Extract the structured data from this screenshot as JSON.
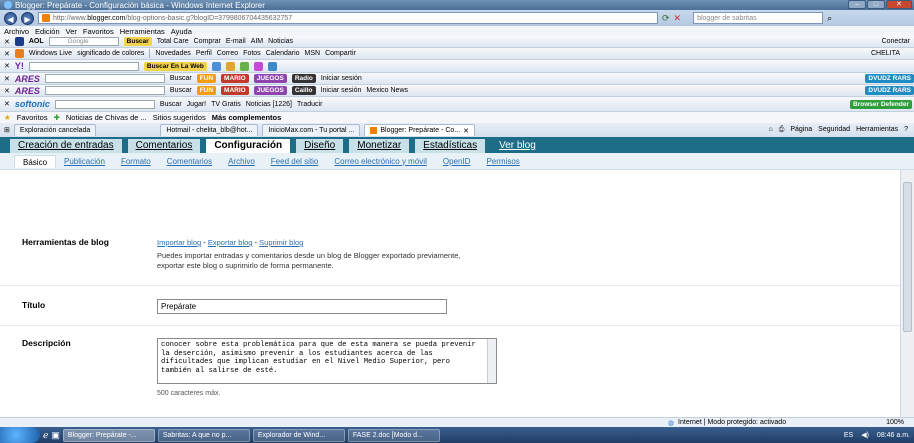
{
  "window": {
    "title": "Blogger: Prepárate - Configuración básica - Windows Internet Explorer"
  },
  "address": {
    "url_prefix": "http://www.",
    "url_domain": "blogger.com",
    "url_rest": "/blog-options-basic.g?blogID=3799806704435632757",
    "search_placeholder": "blogger de sabritas"
  },
  "menu": [
    "Archivo",
    "Edición",
    "Ver",
    "Favoritos",
    "Herramientas",
    "Ayuda"
  ],
  "toolbars": {
    "google": {
      "aol": "AOL",
      "google_label": "Google",
      "buscar": "Buscar",
      "total_care": "Total Care",
      "comprar": "Comprar",
      "email": "E-mail",
      "aim": "AIM",
      "noticias": "Noticias",
      "right": "Conectar"
    },
    "live": {
      "brand": "Windows Live",
      "query": "significado de colores",
      "items": [
        "Novedades",
        "Perfil",
        "Correo",
        "Fotos",
        "Calendario",
        "MSN",
        "Compartir"
      ],
      "user": "CHELITA"
    },
    "yahoo": {
      "buscar": "Buscar En La Web"
    },
    "ares1": {
      "brand": "ARES",
      "buscar": "Buscar",
      "fun": "FUN",
      "mario": "MARIO",
      "juegos": "JUEGOS",
      "radio": "Radio",
      "iniciar": "Iniciar sesión",
      "badge": "DVUDZ RARS"
    },
    "ares2": {
      "brand": "ARES",
      "buscar": "Buscar",
      "fun": "FUN",
      "mario": "MARIO",
      "juegos": "JUEGOS",
      "radio": "Caillo",
      "iniciar": "Iniciar sesión",
      "news": "Mexico News",
      "badge": "DVUDZ RARS"
    },
    "softonic": {
      "brand": "softonic",
      "buscar": "Buscar",
      "jugar": "Jugar!",
      "tv": "TV Gratis",
      "noticias": "Noticias [1226]",
      "traducir": "Traducir",
      "defender": "Browser Defender"
    }
  },
  "favorites": {
    "label": "Favoritos",
    "noticias": "Noticias de Chivas de ...",
    "sitios": "Sitios sugeridos",
    "mas": "Más complementos"
  },
  "tabs": [
    {
      "label": "Exploración cancelada"
    },
    {
      "label": "Hotmail - chelita_blb@hot..."
    },
    {
      "label": "InicioMax.com - Tu portal ..."
    },
    {
      "label": "Blogger: Prepárate - Co..."
    }
  ],
  "cmdbar": {
    "pagina": "Página",
    "seguridad": "Seguridad",
    "herramientas": "Herramientas"
  },
  "blogger_tabs": [
    {
      "label": "Creación de entradas"
    },
    {
      "label": "Comentarios"
    },
    {
      "label": "Configuración"
    },
    {
      "label": "Diseño"
    },
    {
      "label": "Monetizar"
    },
    {
      "label": "Estadísticas"
    },
    {
      "label": "Ver blog"
    }
  ],
  "blogger_subtabs": [
    {
      "label": "Básico"
    },
    {
      "label": "Publicación"
    },
    {
      "label": "Formato"
    },
    {
      "label": "Comentarios"
    },
    {
      "label": "Archivo"
    },
    {
      "label": "Feed del sitio"
    },
    {
      "label": "Correo electrónico y móvil"
    },
    {
      "label": "OpenID"
    },
    {
      "label": "Permisos"
    }
  ],
  "tools": {
    "label": "Herramientas de blog",
    "import": "Importar blog",
    "export": "Exportar blog",
    "delete": "Suprimir blog",
    "sep": " - ",
    "desc": "Puedes importar entradas y comentarios desde un blog de Blogger exportado previamente, exportar este blog o suprimirlo de forma permanente."
  },
  "title_section": {
    "label": "Título",
    "value": "Prepárate"
  },
  "description_section": {
    "label": "Descripción",
    "value": "conocer sobre esta problemática para  que de esta manera se  pueda prevenir la deserción, asimismo prevenir a los estudiantes acerca de las dificultades que implican estudiar en el Nivel Medio Superior,  pero también al salirse de esté.",
    "hint": "500 caracteres máx."
  },
  "status": {
    "zone": "Internet | Modo protegido: activado",
    "zoom": "100%"
  },
  "taskbar": {
    "items": [
      {
        "label": "Blogger: Prepárate -..."
      },
      {
        "label": "Sabritas: A que no p..."
      },
      {
        "label": "Explorador de Wind..."
      },
      {
        "label": "FASE 2.doc [Modo d..."
      }
    ],
    "lang": "ES",
    "time": "08:46 a.m."
  }
}
